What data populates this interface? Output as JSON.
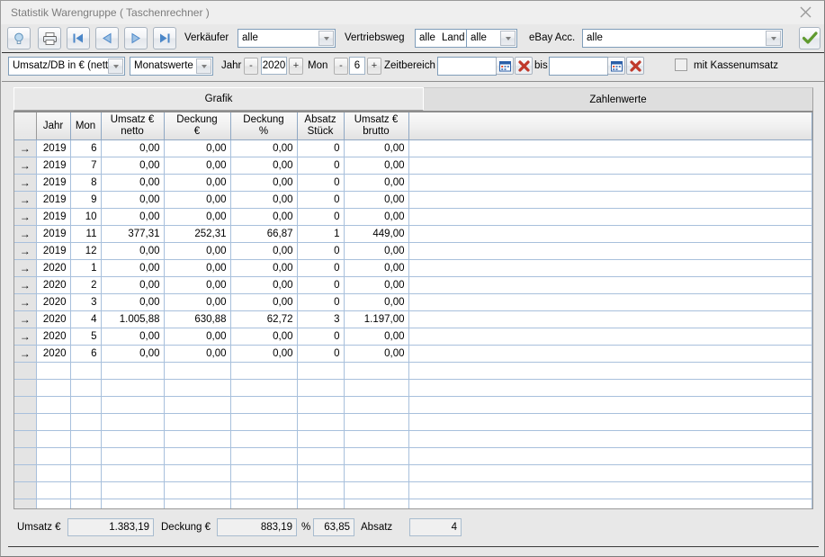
{
  "window": {
    "title": "Statistik Warengruppe ( Taschenrechner )",
    "close_icon": "close-icon"
  },
  "toolbar": {
    "buttons": [
      {
        "name": "lightbulb-icon",
        "label": ""
      },
      {
        "name": "printer-icon",
        "label": ""
      },
      {
        "name": "first-record-icon",
        "label": ""
      },
      {
        "name": "previous-record-icon",
        "label": ""
      },
      {
        "name": "next-record-icon",
        "label": ""
      },
      {
        "name": "last-record-icon",
        "label": ""
      }
    ],
    "verkaeufer_label": "Verkäufer",
    "verkaeufer_value": "alle",
    "vertriebsweg_label": "Vertriebsweg",
    "vertriebsweg_value": "alle",
    "land_label": "Land",
    "land_value": "alle",
    "ebay_label": "eBay Acc.",
    "ebay_value": "alle",
    "confirm_icon": "green-checkmark-icon"
  },
  "filters": {
    "metric_value": "Umsatz/DB in € (netto",
    "period_value": "Monatswerte",
    "jahr_label": "Jahr",
    "jahr_minus": "-",
    "jahr_value": "2020",
    "jahr_plus": "+",
    "mon_label": "Mon",
    "mon_minus": "-",
    "mon_value": "6",
    "mon_plus": "+",
    "zeitbereich_label": "Zeitbereich",
    "zeitbereich_from": "",
    "zeitbereich_from_placeholder": "",
    "bis_label": "bis",
    "zeitbereich_to": "",
    "zeitbereich_to_placeholder": "",
    "calendar_icon": "calendar-icon",
    "clear_icon": "clear-red-x-icon",
    "kassenumsatz_label": "mit Kassenumsatz",
    "kassenumsatz_checked": false
  },
  "tabs": [
    {
      "label": "Grafik",
      "active": false
    },
    {
      "label": "Zahlenwerte",
      "active": true
    }
  ],
  "grid": {
    "columns": [
      {
        "label": "",
        "key": "marker"
      },
      {
        "label": "Jahr",
        "key": "jahr"
      },
      {
        "label": "Mon",
        "key": "mon"
      },
      {
        "label": "Umsatz €\nnetto",
        "key": "umsatz_netto"
      },
      {
        "label": "Deckung\n€",
        "key": "deckung_eur"
      },
      {
        "label": "Deckung\n%",
        "key": "deckung_pct"
      },
      {
        "label": "Absatz\nStück",
        "key": "absatz"
      },
      {
        "label": "Umsatz €\nbrutto",
        "key": "umsatz_brutto"
      },
      {
        "label": "",
        "key": "filler"
      }
    ],
    "row_marker": "→",
    "rows": [
      {
        "jahr": "2019",
        "mon": "6",
        "umsatz_netto": "0,00",
        "deckung_eur": "0,00",
        "deckung_pct": "0,00",
        "absatz": "0",
        "umsatz_brutto": "0,00"
      },
      {
        "jahr": "2019",
        "mon": "7",
        "umsatz_netto": "0,00",
        "deckung_eur": "0,00",
        "deckung_pct": "0,00",
        "absatz": "0",
        "umsatz_brutto": "0,00"
      },
      {
        "jahr": "2019",
        "mon": "8",
        "umsatz_netto": "0,00",
        "deckung_eur": "0,00",
        "deckung_pct": "0,00",
        "absatz": "0",
        "umsatz_brutto": "0,00"
      },
      {
        "jahr": "2019",
        "mon": "9",
        "umsatz_netto": "0,00",
        "deckung_eur": "0,00",
        "deckung_pct": "0,00",
        "absatz": "0",
        "umsatz_brutto": "0,00"
      },
      {
        "jahr": "2019",
        "mon": "10",
        "umsatz_netto": "0,00",
        "deckung_eur": "0,00",
        "deckung_pct": "0,00",
        "absatz": "0",
        "umsatz_brutto": "0,00"
      },
      {
        "jahr": "2019",
        "mon": "11",
        "umsatz_netto": "377,31",
        "deckung_eur": "252,31",
        "deckung_pct": "66,87",
        "absatz": "1",
        "umsatz_brutto": "449,00"
      },
      {
        "jahr": "2019",
        "mon": "12",
        "umsatz_netto": "0,00",
        "deckung_eur": "0,00",
        "deckung_pct": "0,00",
        "absatz": "0",
        "umsatz_brutto": "0,00"
      },
      {
        "jahr": "2020",
        "mon": "1",
        "umsatz_netto": "0,00",
        "deckung_eur": "0,00",
        "deckung_pct": "0,00",
        "absatz": "0",
        "umsatz_brutto": "0,00"
      },
      {
        "jahr": "2020",
        "mon": "2",
        "umsatz_netto": "0,00",
        "deckung_eur": "0,00",
        "deckung_pct": "0,00",
        "absatz": "0",
        "umsatz_brutto": "0,00"
      },
      {
        "jahr": "2020",
        "mon": "3",
        "umsatz_netto": "0,00",
        "deckung_eur": "0,00",
        "deckung_pct": "0,00",
        "absatz": "0",
        "umsatz_brutto": "0,00"
      },
      {
        "jahr": "2020",
        "mon": "4",
        "umsatz_netto": "1.005,88",
        "deckung_eur": "630,88",
        "deckung_pct": "62,72",
        "absatz": "3",
        "umsatz_brutto": "1.197,00"
      },
      {
        "jahr": "2020",
        "mon": "5",
        "umsatz_netto": "0,00",
        "deckung_eur": "0,00",
        "deckung_pct": "0,00",
        "absatz": "0",
        "umsatz_brutto": "0,00"
      },
      {
        "jahr": "2020",
        "mon": "6",
        "umsatz_netto": "0,00",
        "deckung_eur": "0,00",
        "deckung_pct": "0,00",
        "absatz": "0",
        "umsatz_brutto": "0,00"
      }
    ],
    "empty_row_count": 9
  },
  "summary": {
    "umsatz_label": "Umsatz €",
    "umsatz_value": "1.383,19",
    "deckung_label": "Deckung €",
    "deckung_value": "883,19",
    "percent_label": "%",
    "percent_value": "63,85",
    "absatz_label": "Absatz",
    "absatz_value": "4"
  },
  "colors": {
    "accent_blue": "#4a86c8",
    "grid_line": "#a8c0dc",
    "window_bg": "#e8e8e8",
    "title_text": "#7c7c7c",
    "clear_red": "#c0392b",
    "check_green": "#5f9a2f"
  }
}
